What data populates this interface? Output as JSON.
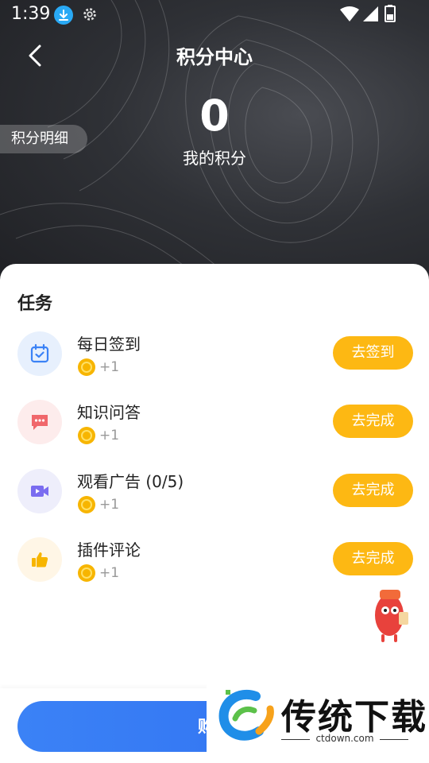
{
  "status_bar": {
    "time": "1:39"
  },
  "header": {
    "title": "积分中心",
    "detail_link": "积分明细",
    "points_value": "0",
    "points_label": "我的积分"
  },
  "tasks_section": {
    "title": "任务",
    "items": [
      {
        "name": "每日签到",
        "reward": "+1",
        "button": "去签到",
        "icon": "calendar-check-icon",
        "icon_bg": "#e7f0fd",
        "icon_color": "#3b82f6"
      },
      {
        "name": "知识问答",
        "reward": "+1",
        "button": "去完成",
        "icon": "chat-bubble-icon",
        "icon_bg": "#fdecec",
        "icon_color": "#f0676b"
      },
      {
        "name": "观看广告 (0/5)",
        "reward": "+1",
        "button": "去完成",
        "icon": "video-camera-icon",
        "icon_bg": "#eeeefb",
        "icon_color": "#7a6cf0"
      },
      {
        "name": "插件评论",
        "reward": "+1",
        "button": "去完成",
        "icon": "thumbs-up-icon",
        "icon_bg": "#fff6e6",
        "icon_color": "#f7b500"
      }
    ]
  },
  "bottom": {
    "buy_label": "购买"
  },
  "watermark": {
    "brand": "传统下载",
    "url": "ctdown.com"
  },
  "colors": {
    "accent_yellow": "#fdb813",
    "primary_blue": "#3b82f6",
    "header_dark": "#2f3136"
  }
}
